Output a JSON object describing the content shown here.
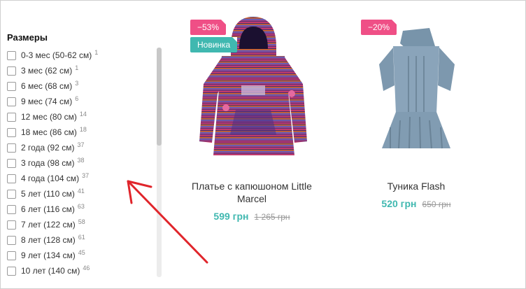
{
  "filter": {
    "title": "Размеры",
    "items": [
      {
        "label": "0-3 мес (50-62 см)",
        "count": "1"
      },
      {
        "label": "3 мес (62 см)",
        "count": "1"
      },
      {
        "label": "6 мес (68 см)",
        "count": "3"
      },
      {
        "label": "9 мес (74 см)",
        "count": "6"
      },
      {
        "label": "12 мес (80 см)",
        "count": "14"
      },
      {
        "label": "18 мес (86 см)",
        "count": "18"
      },
      {
        "label": "2 года (92 см)",
        "count": "37"
      },
      {
        "label": "3 года (98 см)",
        "count": "38"
      },
      {
        "label": "4 года (104 см)",
        "count": "37"
      },
      {
        "label": "5 лет (110 см)",
        "count": "41"
      },
      {
        "label": "6 лет (116 см)",
        "count": "63"
      },
      {
        "label": "7 лет (122 см)",
        "count": "58"
      },
      {
        "label": "8 лет (128 см)",
        "count": "61"
      },
      {
        "label": "9 лет (134 см)",
        "count": "45"
      },
      {
        "label": "10 лет (140 см)",
        "count": "46"
      }
    ]
  },
  "products": [
    {
      "discount_badge": "−53%",
      "new_badge": "Новинка",
      "name": "Платье с капюшоном Little Marcel",
      "price": "599 грн",
      "old_price": "1 265 грн"
    },
    {
      "discount_badge": "−20%",
      "name": "Туника Flash",
      "price": "520 грн",
      "old_price": "650 грн"
    }
  ],
  "colors": {
    "sale_badge": "#ef4f86",
    "new_badge": "#40b8b0",
    "price": "#40b8b0",
    "annotation_arrow": "#e0252b"
  }
}
